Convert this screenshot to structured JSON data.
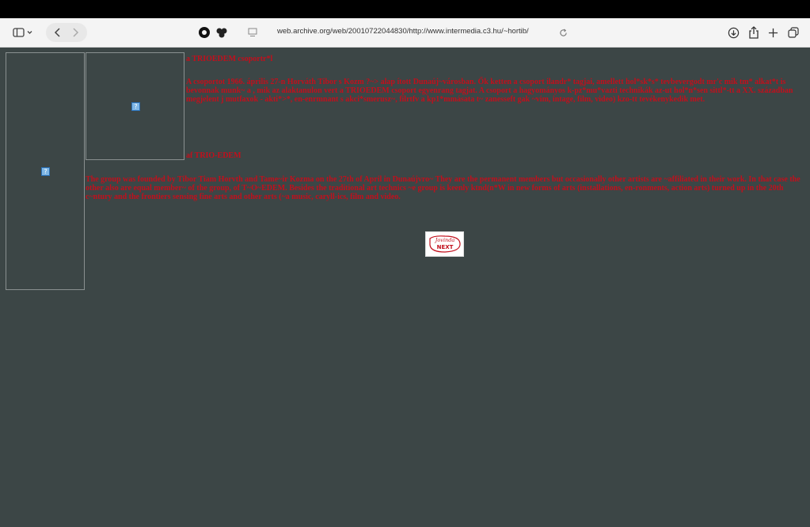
{
  "browser": {
    "url": "web.archive.org/web/20010722044830/http://www.intermedia.c3.hu/~hortib/"
  },
  "page": {
    "hu_title": "a TRIOEDEM csoportr*l",
    "hu_paragraph": "A csoportot 1966. április 27-n Horváth Tibor s Kozm ?~> alap ított Dunaúj~városban. Ők ketten a csoport ilandr* tagjai, amellett hol*sk*s* tevbevergodt mr'c mik tm* alkat*t is bevonnak munk~ a , mik az alaktanulon vert a TRIOEDEM csoport egyenrang tagjat. A csoport a hagyományos k-pz*mu*vazti technikák az-ut hol*n*sen sittl*-tt a XX. században megjelent j mutfaxok - akti*>*, en-enrmnant s akci*smerusz~, filrtfv a kp1*mmásata t~ zanesseft gak ~vim, intage, film, video) kzo-tt tevékenykedik met.",
    "en_title": "af TRIO-EDEM",
    "en_paragraph": "The group was founded by Tibor Tiam Horvth and Tame~ir Kozma on the 27th of April in Dunaújvro~ They are the permanent members but occasionally other artists are ~affiliated in their work. In that case the other also are equal member~ of the group, of T~O~EDEM. Besides the traditional art technics ~e group is keenly ktnd(n*W in new forms of arts (installations, en-ronments, action arts) turned up in the 20th c~ntury and the frontiers sensing fine arts and other arts (~a music, caryll-ics, film and video.",
    "next_label": "NEXT",
    "next_script": "Jovinda"
  }
}
